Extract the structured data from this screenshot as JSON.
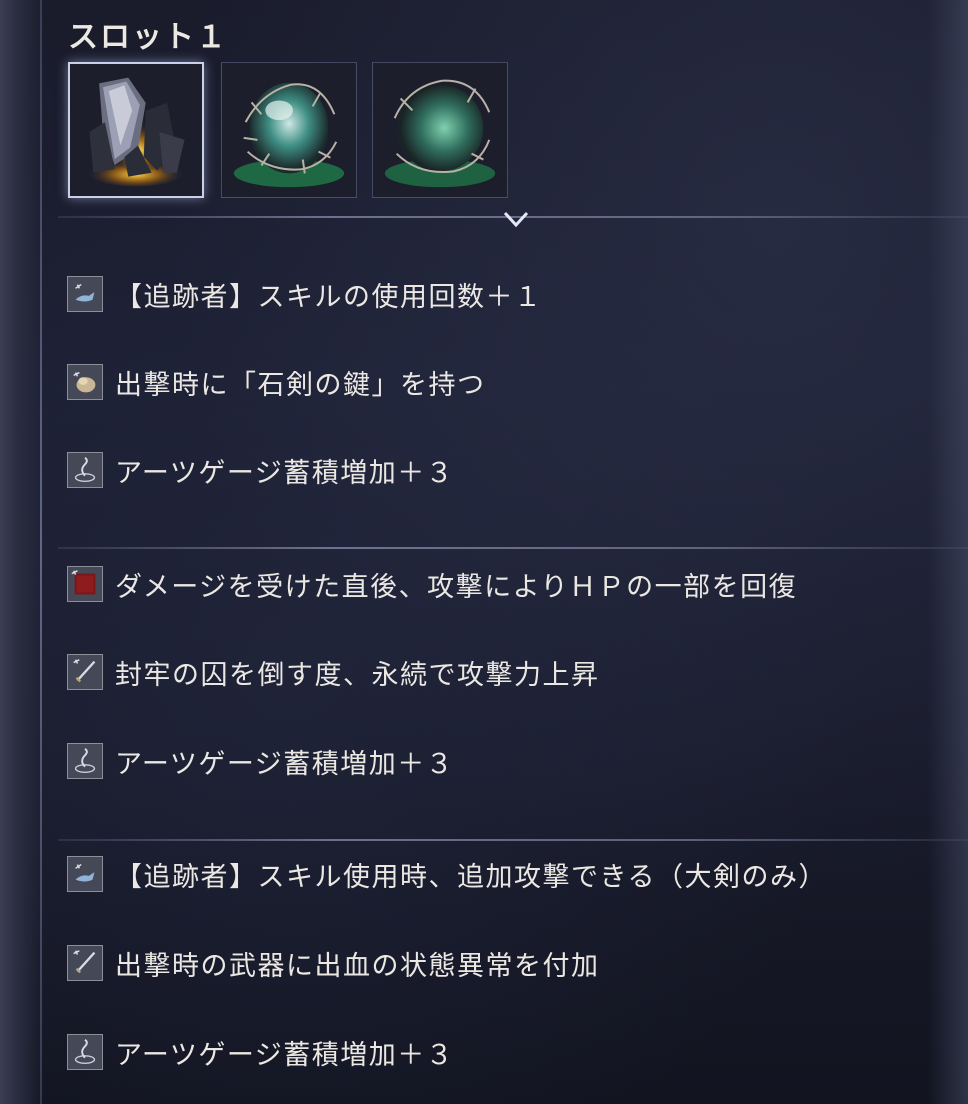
{
  "slot": {
    "title": "スロット１"
  },
  "relics": [
    {
      "name_icon": "gold-shard-relic-icon",
      "selected": true
    },
    {
      "name_icon": "green-thorn-relic-icon",
      "selected": false
    },
    {
      "name_icon": "green-moon-relic-icon",
      "selected": false
    }
  ],
  "groups": [
    {
      "effects": [
        {
          "icon": "hand-skill-icon",
          "text": "【追跡者】スキルの使用回数＋１"
        },
        {
          "icon": "pouch-item-icon",
          "text": "出撃時に「石剣の鍵」を持つ"
        },
        {
          "icon": "arts-gauge-icon",
          "text": "アーツゲージ蓄積増加＋３"
        }
      ]
    },
    {
      "effects": [
        {
          "icon": "red-square-icon",
          "text": "ダメージを受けた直後、攻撃によりＨＰの一部を回復"
        },
        {
          "icon": "sword-icon",
          "text": "封牢の囚を倒す度、永続で攻撃力上昇"
        },
        {
          "icon": "arts-gauge-icon",
          "text": "アーツゲージ蓄積増加＋３"
        }
      ]
    },
    {
      "effects": [
        {
          "icon": "hand-skill-icon",
          "text": "【追跡者】スキル使用時、追加攻撃できる（大剣のみ）"
        },
        {
          "icon": "sword-icon",
          "text": "出撃時の武器に出血の状態異常を付加"
        },
        {
          "icon": "arts-gauge-icon",
          "text": "アーツゲージ蓄積増加＋３"
        }
      ]
    }
  ]
}
